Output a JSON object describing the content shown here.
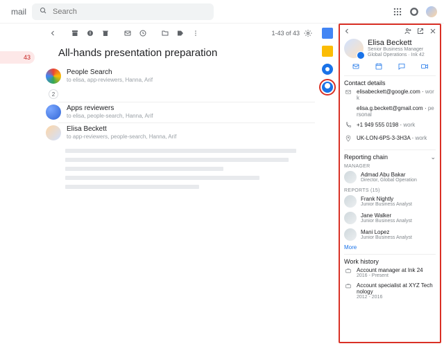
{
  "header": {
    "logo_text": "mail",
    "search_placeholder": "Search"
  },
  "left_rail": {
    "badge": "43"
  },
  "toolbar": {
    "counter": "1-43 of 43"
  },
  "subject": "All-hands presentation preparation",
  "thread": [
    {
      "name": "People Search",
      "meta": "to elisa, app-reviewers, Hanna, Arif"
    },
    {
      "name": "Apps reviewers",
      "meta": "to elisa, people-search, Hanna, Arif"
    },
    {
      "name": "Elisa Beckett",
      "meta": "to app-reviewers, people-search, Hanna, Arif"
    }
  ],
  "thread_count_chip": "2",
  "contact": {
    "name": "Elisa Beckett",
    "title": "Senior Business Manager",
    "subtitle": "Global Operations · Ink 42",
    "sections": {
      "contact_h": "Contact details",
      "emails": [
        {
          "value": "elisabeckett@google.com",
          "tag": "work"
        },
        {
          "value": "elisa.g.beckett@gmail.com",
          "tag": "personal"
        }
      ],
      "phone": {
        "value": "+1 949 555 0198",
        "tag": "work"
      },
      "location": {
        "value": "UK-LON-6PS-3-3H3A",
        "tag": "work"
      },
      "chain_h": "Reporting chain",
      "manager_label": "MANAGER",
      "manager": {
        "name": "Admad Abu Bakar",
        "title": "Director, Global Operation"
      },
      "reports_label": "REPORTS (15)",
      "reports": [
        {
          "name": "Frank Nightly",
          "title": "Junior Business Analyst"
        },
        {
          "name": "Jane Walker",
          "title": "Junior Business Analyst"
        },
        {
          "name": "Mani Lopez",
          "title": "Junior Business Analyst"
        }
      ],
      "more": "More",
      "work_h": "Work history",
      "work": [
        {
          "role": "Account manager at Ink 24",
          "dates": "2016 - Present"
        },
        {
          "role": "Account specialist at XYZ Technology",
          "dates": "2012 - 2016"
        }
      ]
    }
  }
}
